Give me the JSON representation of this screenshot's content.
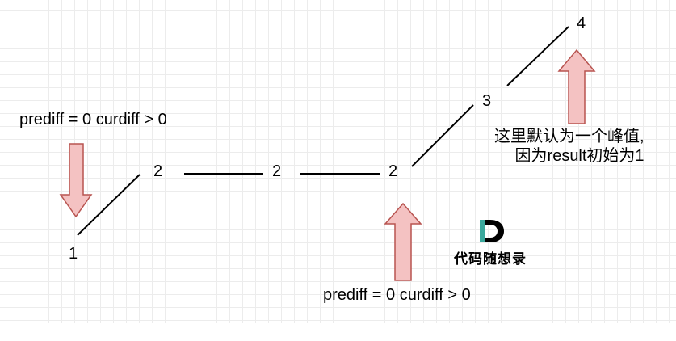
{
  "nodes": [
    {
      "id": "n1",
      "label": "1"
    },
    {
      "id": "n2a",
      "label": "2"
    },
    {
      "id": "n2b",
      "label": "2"
    },
    {
      "id": "n2c",
      "label": "2"
    },
    {
      "id": "n3",
      "label": "3"
    },
    {
      "id": "n4",
      "label": "4"
    }
  ],
  "annotations": {
    "left": "prediff = 0 curdiff > 0",
    "bottom": "prediff = 0 curdiff > 0",
    "peak_line1": "这里默认为一个峰值,",
    "peak_line2": "因为result初始为1"
  },
  "logo": {
    "letter": "D",
    "text": "代码随想录"
  },
  "colors": {
    "arrow_fill": "#f4c2c2",
    "arrow_stroke": "#b85450",
    "line": "#000000",
    "grid": "#ececec",
    "logo_accent": "#3aa89c"
  }
}
